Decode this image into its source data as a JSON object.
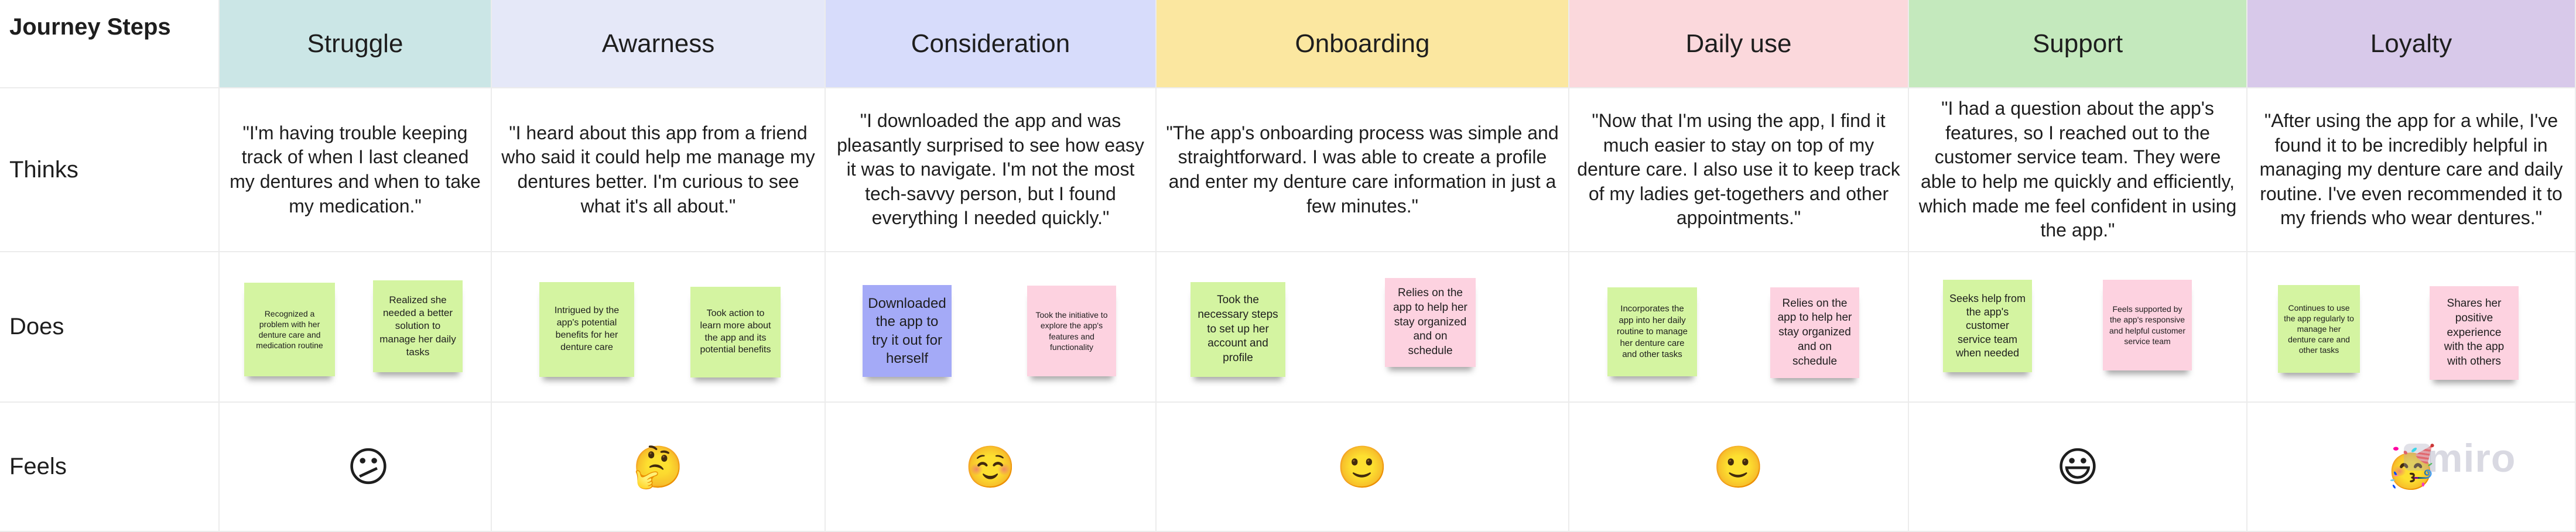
{
  "corner_title": "Journey Steps",
  "colors": {
    "struggle": "#cbe6e6",
    "awareness": "#e5e8f8",
    "consideration": "#d7dcfb",
    "onboarding": "#fbe7a0",
    "daily_use": "#fbd8dc",
    "support": "#c4e9bd",
    "loyalty": "#d8c9ea",
    "sticky_green": "#d4f4a1",
    "sticky_pink": "#fdd2e0",
    "sticky_blue": "#a4aaf7"
  },
  "rows": {
    "thinks": "Thinks",
    "does": "Does",
    "feels": "Feels"
  },
  "stages": [
    {
      "name": "Struggle",
      "thinks": "\"I'm having trouble keeping track of when I last cleaned my dentures and when to take my medication.\"",
      "does": [
        {
          "text": "Recognized a problem with her denture care and medication routine",
          "color": "green"
        },
        {
          "text": "Realized she needed a better solution to manage her daily tasks",
          "color": "green"
        }
      ],
      "feels": "😕"
    },
    {
      "name": "Awarness",
      "thinks": "\"I heard about this app from a friend who said it could help me manage my dentures better. I'm curious to see what it's all about.\"",
      "does": [
        {
          "text": "Intrigued by the app's potential benefits for her denture care",
          "color": "green"
        },
        {
          "text": "Took action to learn more about the app and its potential benefits",
          "color": "green"
        }
      ],
      "feels": "🤔"
    },
    {
      "name": "Consideration",
      "thinks": "\"I downloaded the app and was pleasantly surprised to see how easy it was to navigate. I'm not the most tech-savvy person, but I found everything I needed quickly.\"",
      "does": [
        {
          "text": "Downloaded the app to try it out for herself",
          "color": "blue"
        },
        {
          "text": "Took the initiative to explore the app's features and functionality",
          "color": "pink"
        }
      ],
      "feels": "☺️"
    },
    {
      "name": "Onboarding",
      "thinks": "\"The app's onboarding process was simple and straightforward. I was able to create a profile and enter my denture care information in just a few minutes.\"",
      "does": [
        {
          "text": "Took the necessary steps to set up her account and profile",
          "color": "green"
        },
        {
          "text": "Relies on the app to help her stay organized and on schedule",
          "color": "pink"
        }
      ],
      "feels": "🙂"
    },
    {
      "name": "Daily use",
      "thinks": "\"Now that I'm using the app, I find it much easier to stay on top of my denture care. I also use it to keep track of my ladies get-togethers and other appointments.\"",
      "does": [
        {
          "text": "Incorporates the app into her daily routine to manage her denture care and other tasks",
          "color": "green"
        },
        {
          "text": "Relies on the app to help her stay organized and on schedule",
          "color": "pink"
        }
      ],
      "feels": "🙂"
    },
    {
      "name": "Support",
      "thinks": "\"I had a question about the app's features, so I reached out to the customer service team. They were able to help me quickly and efficiently, which made me feel confident in using the app.\"",
      "does": [
        {
          "text": "Seeks help from the app's customer service team when needed",
          "color": "green"
        },
        {
          "text": "Feels supported by the app's responsive and helpful customer service team",
          "color": "pink"
        }
      ],
      "feels": "😃"
    },
    {
      "name": "Loyalty",
      "thinks": "\"After using the app for a while, I've found it to be incredibly helpful in managing my denture care and daily routine. I've even recommended it to my friends who wear dentures.\"",
      "does": [
        {
          "text": "Continues to use the app regularly to manage her denture care and other tasks",
          "color": "green"
        },
        {
          "text": "Shares her positive experience with the app with others",
          "color": "pink"
        }
      ],
      "feels": "🥳"
    }
  ],
  "watermark": "miro"
}
